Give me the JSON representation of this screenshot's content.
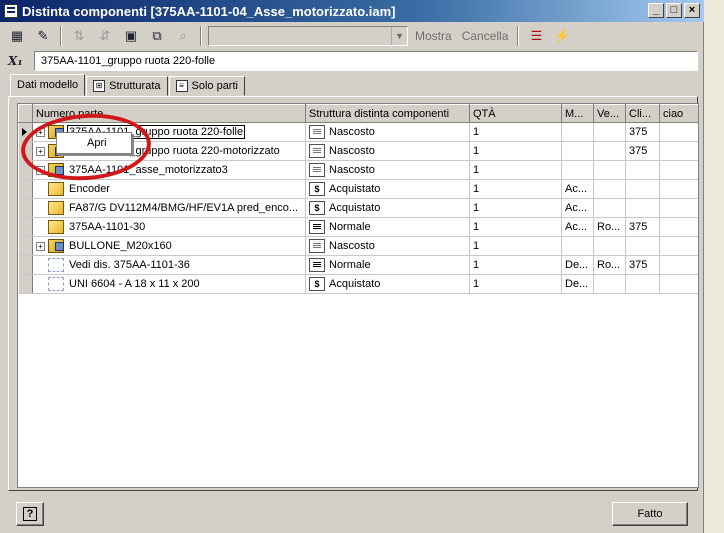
{
  "window": {
    "title": "Distinta componenti [375AA-1101-04_Asse_motorizzato.iam]",
    "controls": [
      "_",
      "□",
      "×"
    ]
  },
  "toolbar": {
    "icons": [
      "view-icon",
      "edit-icon",
      "sort-ascending-icon",
      "sort-descending-icon",
      "new-document-icon",
      "export-icon",
      "find-icon"
    ],
    "combo_value": "",
    "mostra_label": "Mostra",
    "cancella_label": "Cancella",
    "extra_icons": [
      "column-chooser-icon",
      "merge-icon"
    ]
  },
  "formula": {
    "icon_label": "X",
    "value": "375AA-1101_gruppo ruota 220-folle"
  },
  "tabs": [
    {
      "label": "Dati modello",
      "active": true
    },
    {
      "label": "Strutturata",
      "active": false
    },
    {
      "label": "Solo parti",
      "active": false
    }
  ],
  "table": {
    "columns": [
      "Numero parte",
      "Struttura distinta componenti",
      "QTÀ",
      "M...",
      "Ve...",
      "Cli...",
      "ciao"
    ],
    "rows": [
      {
        "expand": "+",
        "icon": "asm",
        "name": "375AA-1101_gruppo ruota 220-folle",
        "struct_icon": "hidden",
        "struct": "Nascosto",
        "qty": "1",
        "m": "",
        "ve": "",
        "cli": "375",
        "ciao": "",
        "selected": true
      },
      {
        "expand": "+",
        "icon": "asm",
        "name": "375AA-1101_gruppo ruota 220-motorizzato",
        "struct_icon": "hidden",
        "struct": "Nascosto",
        "qty": "1",
        "m": "",
        "ve": "",
        "cli": "375",
        "ciao": ""
      },
      {
        "expand": "+",
        "icon": "asm",
        "name": "375AA-1101_asse_motorizzato3",
        "struct_icon": "hidden",
        "struct": "Nascosto",
        "qty": "1",
        "m": "",
        "ve": "",
        "cli": "",
        "ciao": ""
      },
      {
        "expand": "",
        "icon": "part",
        "name": "Encoder",
        "struct_icon": "purchased",
        "struct": "Acquistato",
        "qty": "1",
        "m": "Ac...",
        "ve": "",
        "cli": "",
        "ciao": ""
      },
      {
        "expand": "",
        "icon": "part",
        "name": "FA87/G DV112M4/BMG/HF/EV1A pred_enco...",
        "struct_icon": "purchased",
        "struct": "Acquistato",
        "qty": "1",
        "m": "Ac...",
        "ve": "",
        "cli": "",
        "ciao": ""
      },
      {
        "expand": "",
        "icon": "part",
        "name": "375AA-1101-30",
        "struct_icon": "normal",
        "struct": "Normale",
        "qty": "1",
        "m": "Ac...",
        "ve": "Ro...",
        "cli": "375",
        "ciao": ""
      },
      {
        "expand": "+",
        "icon": "asm",
        "name": "BULLONE_M20x160",
        "struct_icon": "hidden",
        "struct": "Nascosto",
        "qty": "1",
        "m": "",
        "ve": "",
        "cli": "",
        "ciao": ""
      },
      {
        "expand": "",
        "icon": "virt",
        "name": "Vedi dis. 375AA-1101-36",
        "struct_icon": "normal",
        "struct": "Normale",
        "qty": "1",
        "m": "De...",
        "ve": "Ro...",
        "cli": "375",
        "ciao": ""
      },
      {
        "expand": "",
        "icon": "virt",
        "name": "UNI 6604 - A 18 x 11 x 200",
        "struct_icon": "purchased",
        "struct": "Acquistato",
        "qty": "1",
        "m": "De...",
        "ve": "",
        "cli": "",
        "ciao": ""
      }
    ]
  },
  "context_menu": {
    "items": [
      "Apri"
    ]
  },
  "footer": {
    "help_label": "?",
    "done_label": "Fatto"
  },
  "colors": {
    "title_start": "#0a246a",
    "title_end": "#a6caf0",
    "annotation": "#d01818"
  }
}
